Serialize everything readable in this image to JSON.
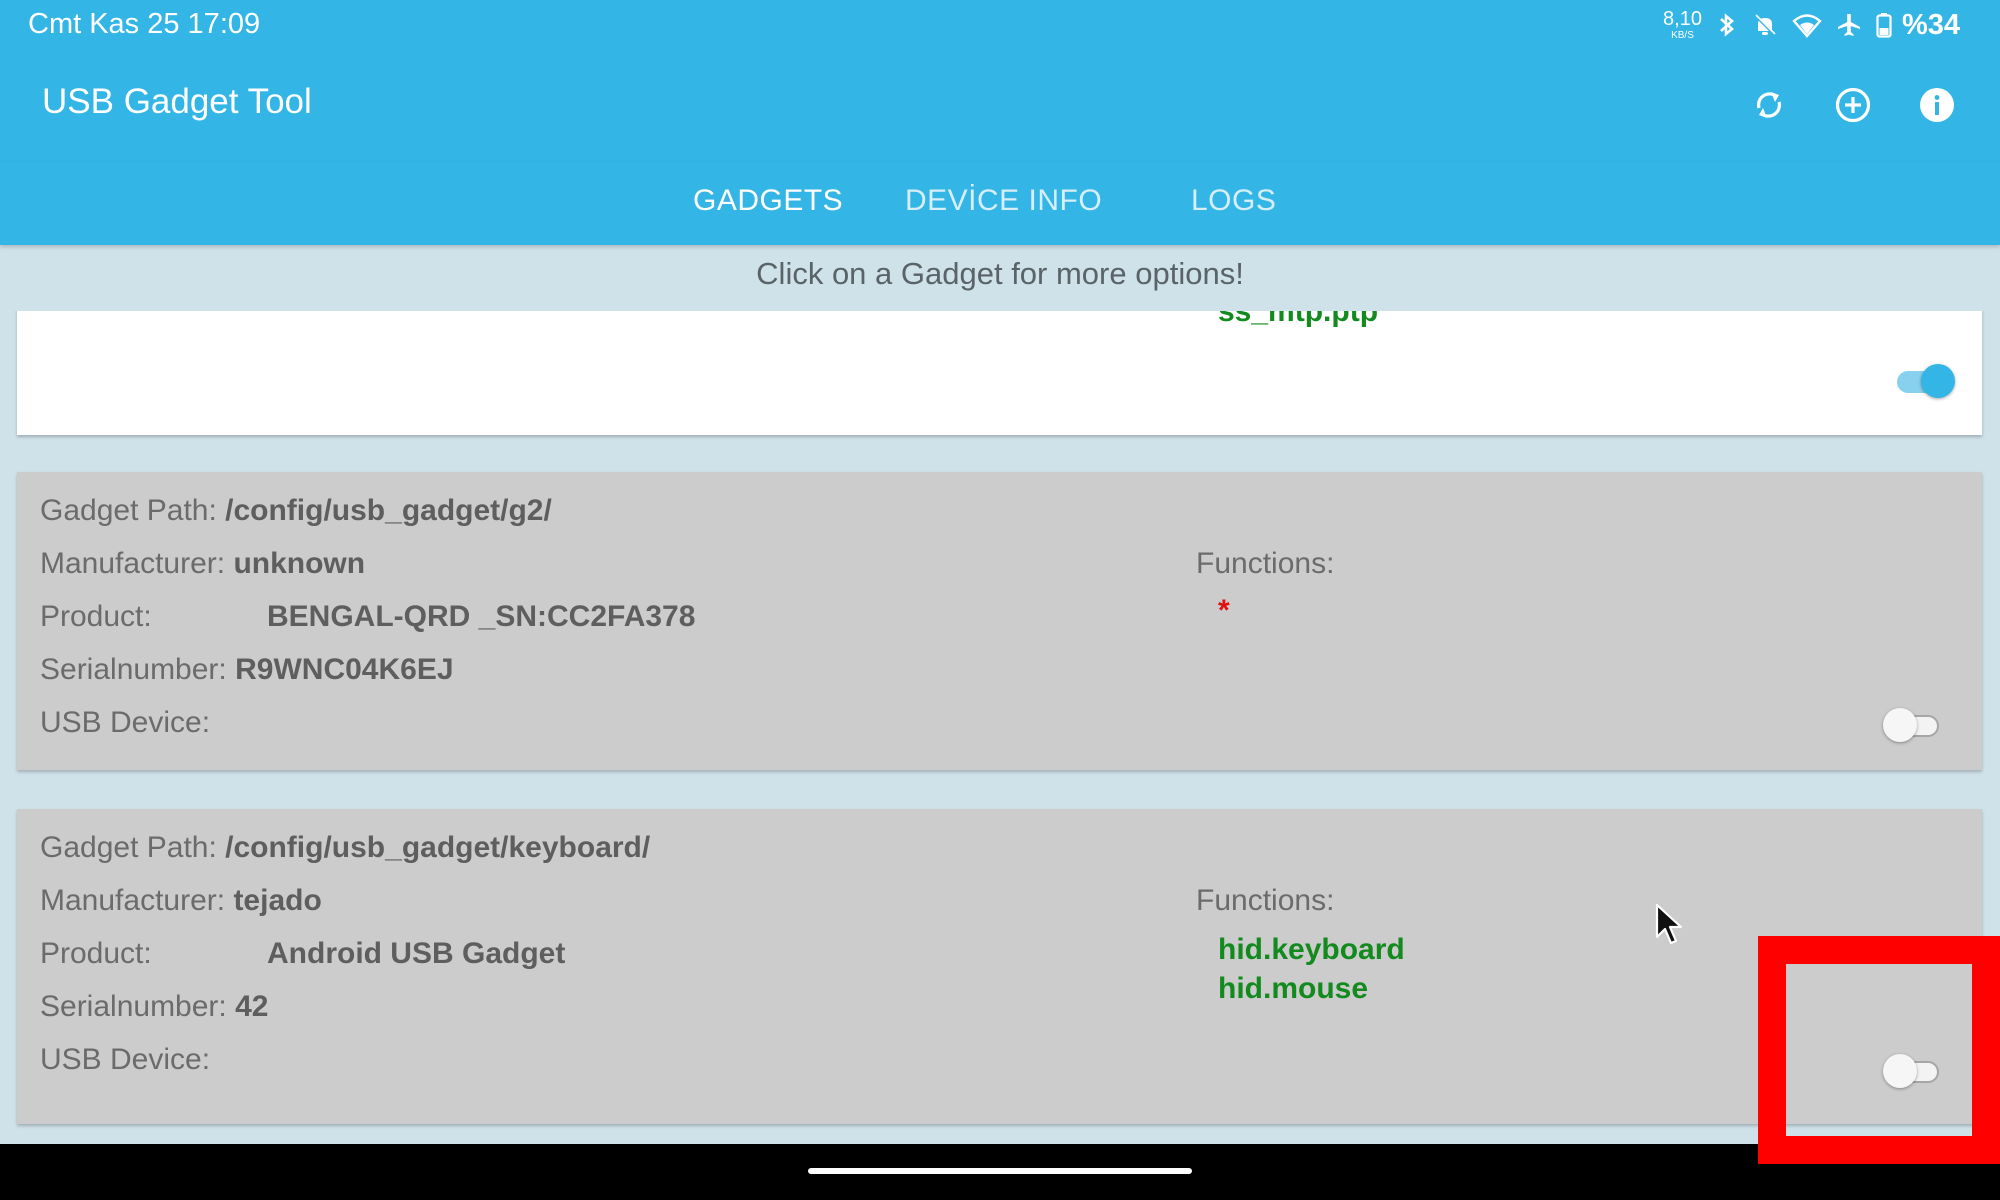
{
  "status_bar": {
    "time": "Cmt Kas 25 17:09",
    "net_speed_value": "8,10",
    "net_speed_unit": "KB/S",
    "battery": "%34",
    "icons": [
      "bluetooth-icon",
      "bell-off-icon",
      "wifi-icon",
      "airplane-icon",
      "battery-icon"
    ]
  },
  "app_bar": {
    "title": "USB Gadget Tool",
    "actions": [
      "refresh-icon",
      "add-circle-icon",
      "info-icon"
    ]
  },
  "tabs": [
    {
      "label": "GADGETS",
      "active": true
    },
    {
      "label": "DEVİCE INFO",
      "active": false
    },
    {
      "label": "LOGS",
      "active": false
    }
  ],
  "hint": "Click on a Gadget for more options!",
  "labels": {
    "gadget_path": "Gadget Path:",
    "manufacturer": "Manufacturer:",
    "product": "Product:",
    "serialnumber": "Serialnumber:",
    "usb_device": "USB Device:",
    "functions": "Functions:"
  },
  "gadgets": [
    {
      "partial": true,
      "functions": [
        "ss_mtp.ptp"
      ],
      "enabled": true
    },
    {
      "path": "/config/usb_gadget/g2/",
      "manufacturer": "unknown",
      "product": "BENGAL-QRD _SN:CC2FA378",
      "serialnumber": "R9WNC04K6EJ",
      "usb_device": "",
      "functions_marker": "*",
      "functions": [],
      "enabled": false
    },
    {
      "path": "/config/usb_gadget/keyboard/",
      "manufacturer": "tejado",
      "product": "Android USB Gadget",
      "serialnumber": "42",
      "usb_device": "",
      "functions": [
        "hid.keyboard",
        "hid.mouse"
      ],
      "enabled": false
    }
  ],
  "colors": {
    "primary": "#33b5e5",
    "background": "#cfe1e9",
    "function_green": "#138a1e",
    "marker_red": "#e01010",
    "highlight_red": "#ff0000"
  }
}
